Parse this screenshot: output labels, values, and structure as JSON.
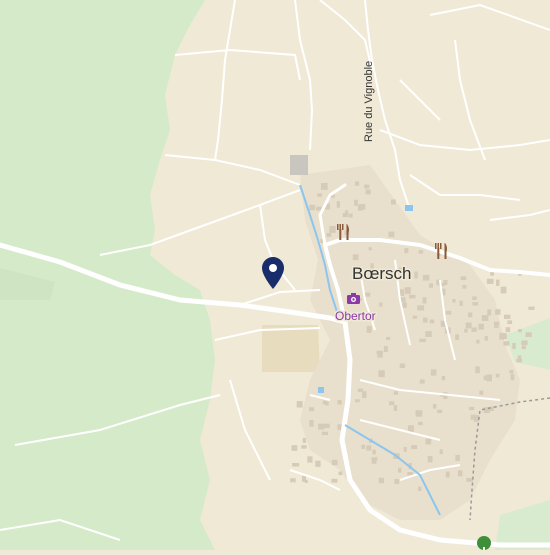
{
  "map": {
    "labels": {
      "town": "Bœrsch",
      "street": "Rue du Vignoble",
      "poi": "Obertor"
    },
    "icons": {
      "location_pin": "location-pin-icon",
      "restaurant": "fork-knife-icon",
      "camera": "camera-icon",
      "tree": "tree-icon"
    },
    "colors": {
      "land": "#f0e9d6",
      "forest": "#d5eac9",
      "road": "#ffffff",
      "water": "#8cc5f0",
      "buildings": "#ddd3c0",
      "poi": "#8b3aa8",
      "restaurant": "#8a5a3a",
      "pin": "#1a2d6b",
      "boundary": "#9a9a9a"
    }
  }
}
